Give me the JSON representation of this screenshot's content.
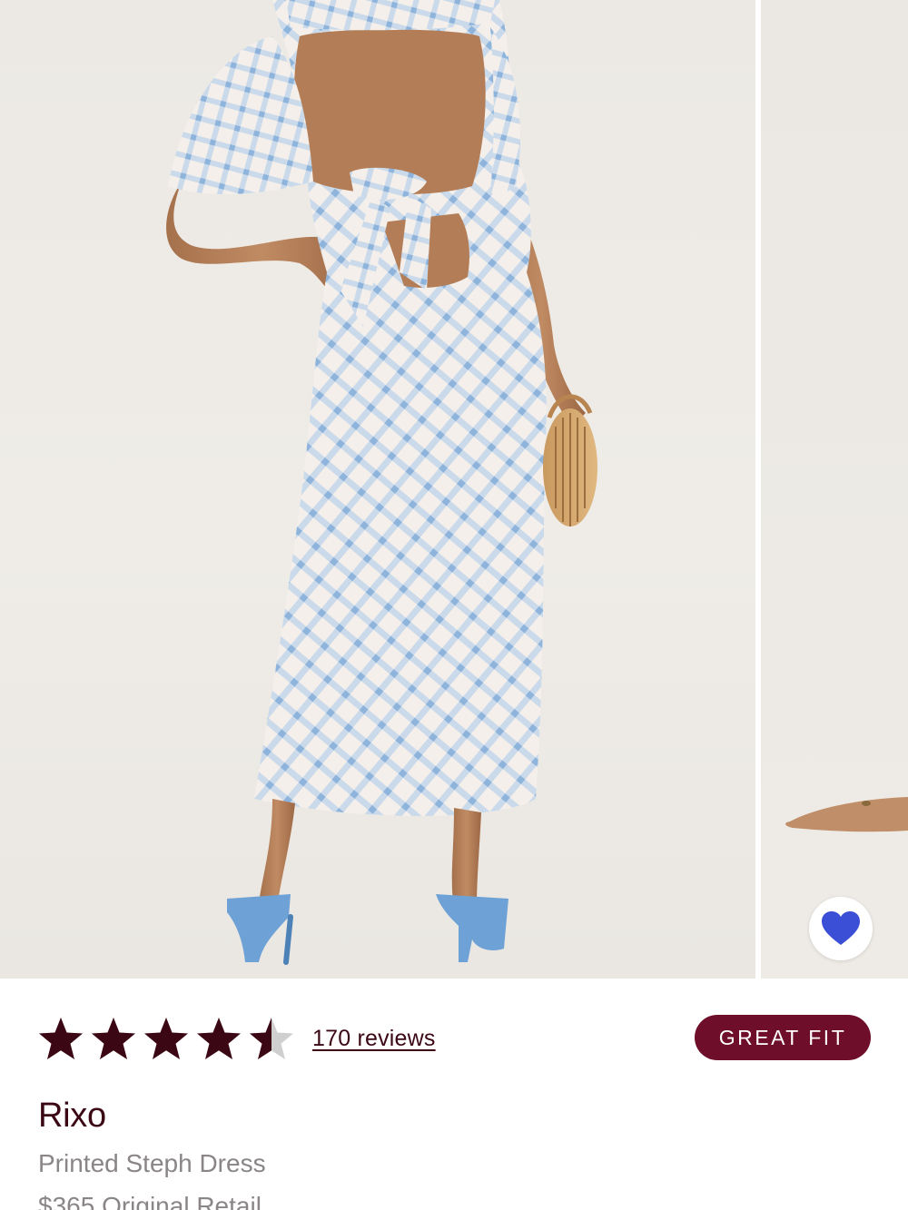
{
  "colors": {
    "accent": "#6e0e2a",
    "star": "#3b0715",
    "star_empty": "#cfcfcf",
    "heart": "#3b4fd6",
    "muted_text": "#8a8587"
  },
  "gallery": {
    "favorite_icon": "heart-icon"
  },
  "rating": {
    "stars": 4.5,
    "out_of": 5,
    "reviews_label": "170 reviews"
  },
  "fit_badge": "GREAT FIT",
  "product": {
    "brand": "Rixo",
    "name": "Printed Steph Dress",
    "price_label": "$365 Original Retail"
  }
}
